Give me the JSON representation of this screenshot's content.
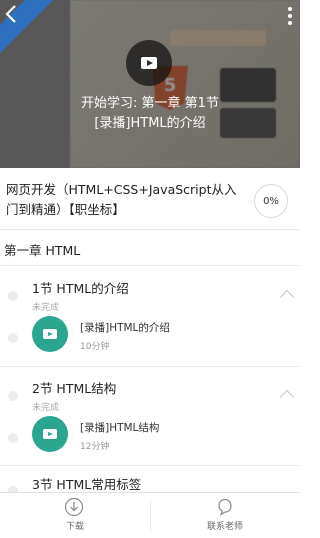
{
  "video": {
    "line1": "开始学习: 第一章 第1节",
    "line2": "[录播]HTML的介绍",
    "art_badge": "5",
    "icons": {
      "back": "back-arrow-icon",
      "more": "more-vertical-icon",
      "play": "play-icon"
    }
  },
  "course": {
    "title": "网页开发（HTML+CSS+JavaScript从入门到精通）【职坐标】",
    "progress": "0%"
  },
  "chapter": {
    "title": "第一章 HTML"
  },
  "sections": [
    {
      "title": "1节  HTML的介绍",
      "status": "未完成",
      "lesson_title": "[录播]HTML的介绍",
      "lesson_duration": "10分钟"
    },
    {
      "title": "2节  HTML结构",
      "status": "未完成",
      "lesson_title": "[录播]HTML结构",
      "lesson_duration": "12分钟"
    },
    {
      "title": "3节  HTML常用标签"
    }
  ],
  "bottombar": {
    "download_label": "下载",
    "contact_label": "联系老师",
    "icons": {
      "download": "download-icon",
      "contact": "contact-teacher-icon"
    }
  },
  "colors": {
    "accent_green": "#2aa58f",
    "ribbon_blue": "#2f6fc0",
    "html5_orange": "#e65e2e"
  }
}
